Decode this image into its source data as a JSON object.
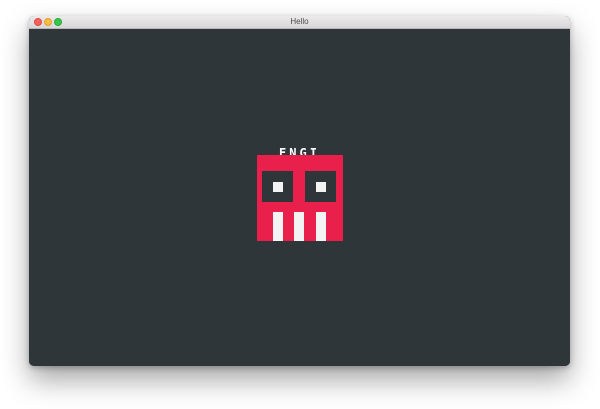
{
  "window": {
    "title": "Hello"
  },
  "splash": {
    "logo_text": "ENGI"
  },
  "colors": {
    "background": "#2f363a",
    "logo_red": "#e8204b",
    "logo_dark": "#2f363a",
    "logo_light": "#f3f3f3"
  },
  "icons": {
    "close": "close-icon",
    "minimize": "minimize-icon",
    "zoom": "zoom-icon",
    "logo": "engi-robot-logo"
  }
}
